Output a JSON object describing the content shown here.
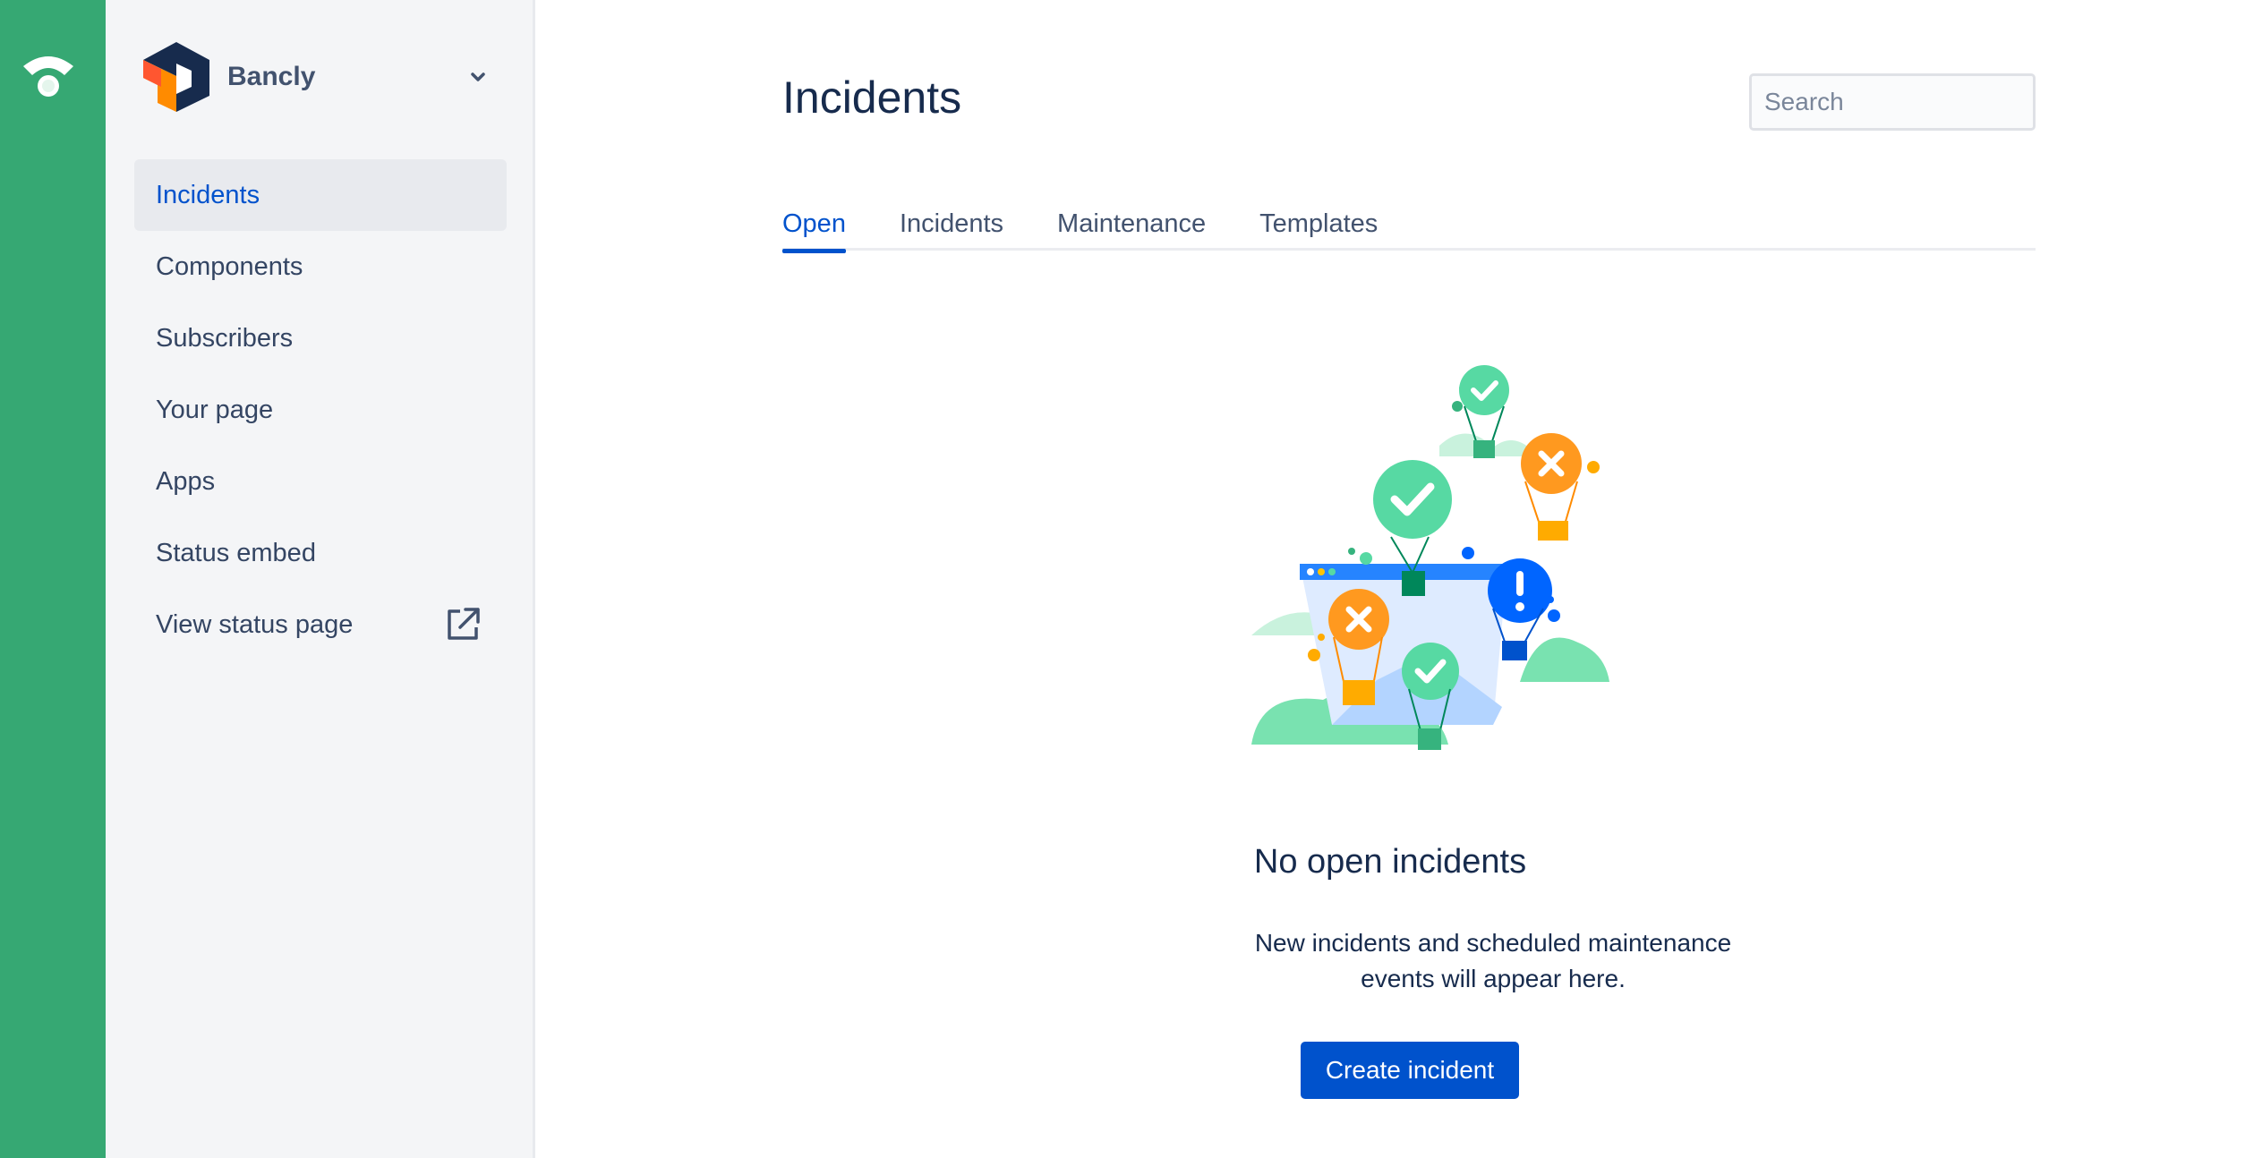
{
  "org": {
    "name": "Bancly"
  },
  "sidebar": {
    "items": [
      {
        "label": "Incidents",
        "active": true
      },
      {
        "label": "Components"
      },
      {
        "label": "Subscribers"
      },
      {
        "label": "Your page"
      },
      {
        "label": "Apps"
      },
      {
        "label": "Status embed"
      },
      {
        "label": "View status page",
        "icon": "external-link-icon"
      }
    ]
  },
  "header": {
    "title": "Incidents",
    "search_placeholder": "Search"
  },
  "tabs": [
    {
      "label": "Open",
      "active": true
    },
    {
      "label": "Incidents"
    },
    {
      "label": "Maintenance"
    },
    {
      "label": "Templates"
    }
  ],
  "empty_state": {
    "title": "No open incidents",
    "description_line1": "New incidents and scheduled maintenance",
    "description_line2": "events will appear here.",
    "button_label": "Create incident"
  },
  "colors": {
    "rail": "#36a873",
    "primary": "#0052cc",
    "sidebar_bg": "#f4f5f7"
  }
}
